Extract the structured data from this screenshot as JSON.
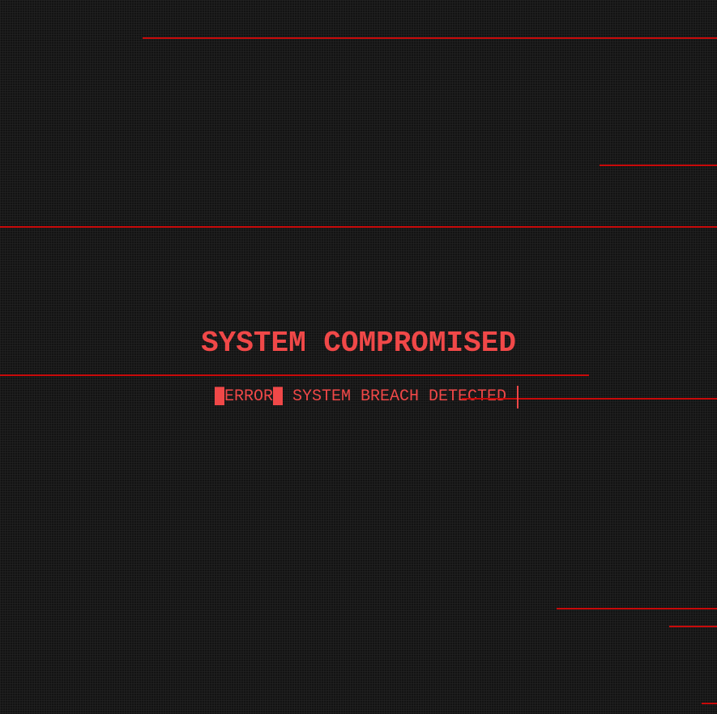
{
  "title": "SYSTEM COMPROMISED",
  "subtitle": "█ERROR█ SYSTEM BREACH DETECTED",
  "colors": {
    "text": "#f04848",
    "glitch_line": "#c80a0a",
    "background": "#131313"
  }
}
